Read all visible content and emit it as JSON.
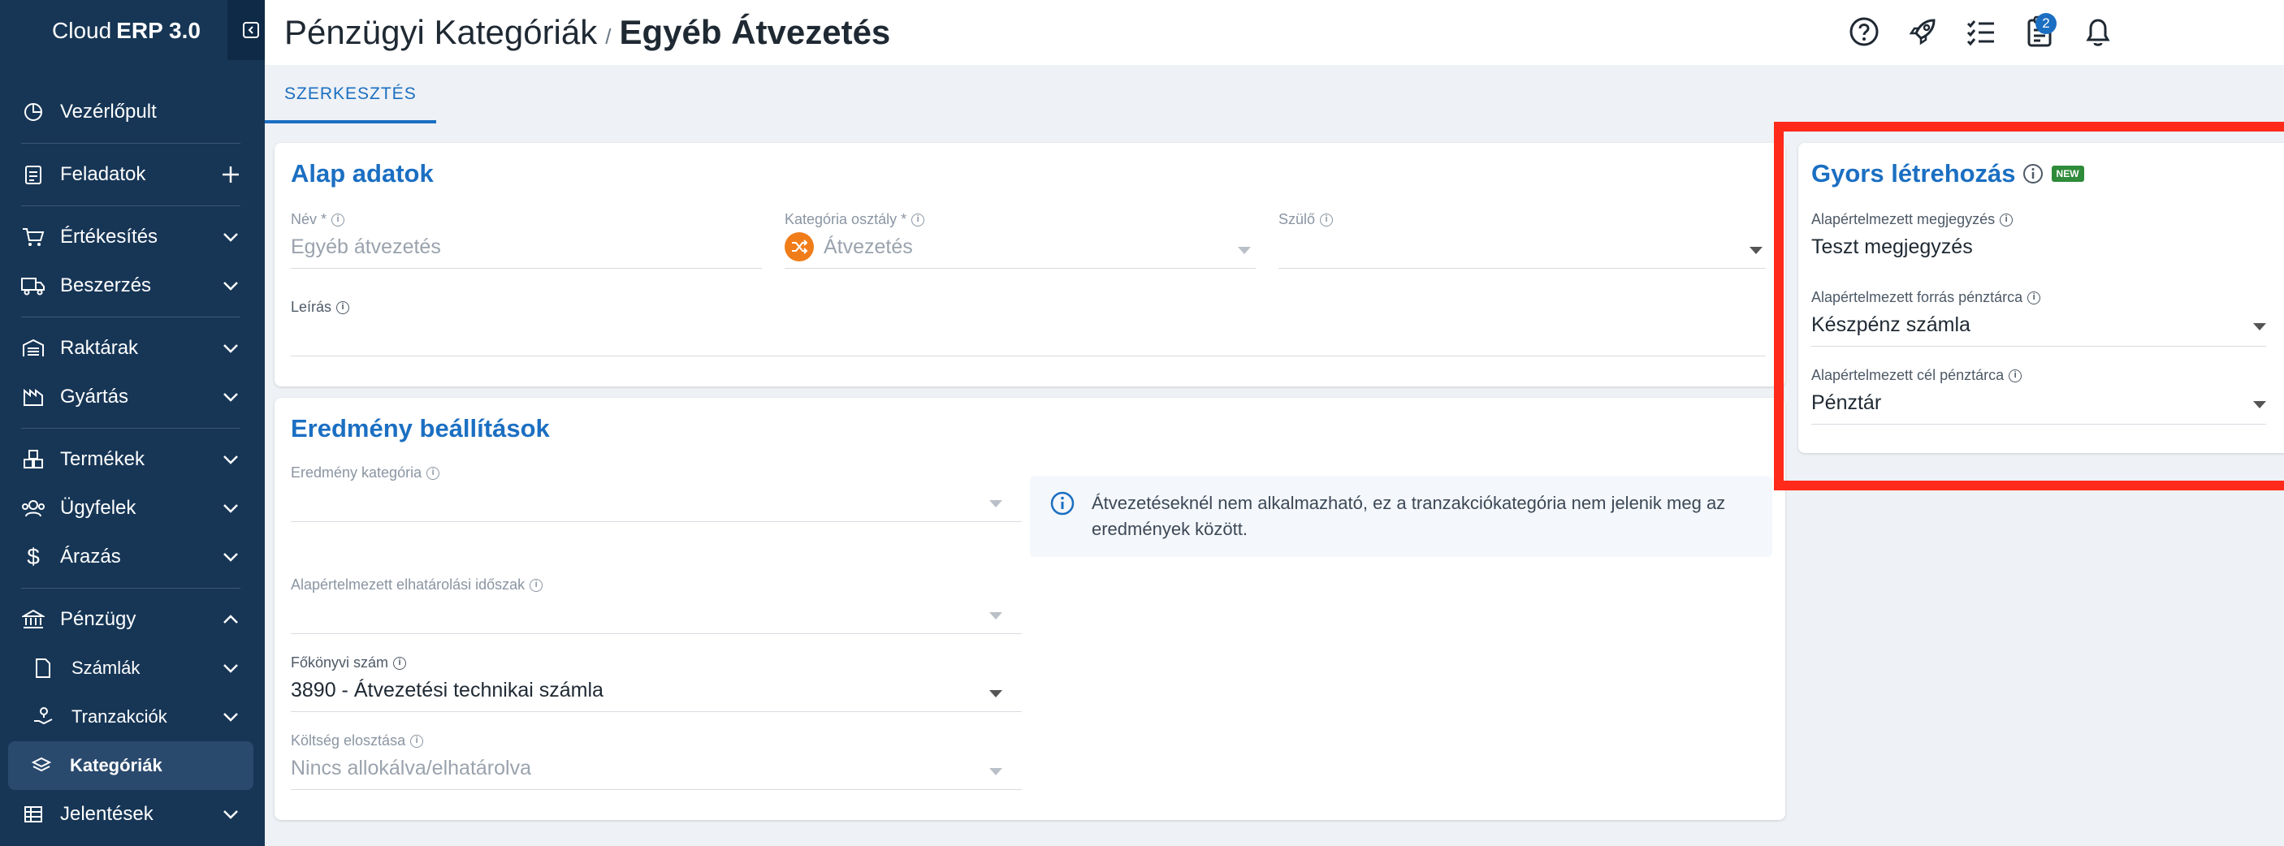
{
  "app": {
    "brand_prefix": "Cloud",
    "brand_bold": "ERP 3.0"
  },
  "sidebar": {
    "items": [
      {
        "label": "Vezérlőpult",
        "icon": "dashboard-icon"
      },
      {
        "label": "Feladatok",
        "icon": "clipboard-icon",
        "action": "plus-icon"
      },
      {
        "label": "Értékesítés",
        "icon": "cart-icon"
      },
      {
        "label": "Beszerzés",
        "icon": "truck-icon"
      },
      {
        "label": "Raktárak",
        "icon": "warehouse-icon"
      },
      {
        "label": "Gyártás",
        "icon": "factory-icon"
      },
      {
        "label": "Termékek",
        "icon": "boxes-icon"
      },
      {
        "label": "Ügyfelek",
        "icon": "users-icon"
      },
      {
        "label": "Árazás",
        "icon": "dollar-icon"
      },
      {
        "label": "Pénzügy",
        "icon": "bank-icon"
      },
      {
        "label": "Számlák",
        "icon": "file-icon"
      },
      {
        "label": "Tranzakciók",
        "icon": "hand-coin-icon"
      },
      {
        "label": "Kategóriák",
        "icon": "layers-icon"
      },
      {
        "label": "Jelentések",
        "icon": "table-icon"
      }
    ]
  },
  "header": {
    "breadcrumb_parent": "Pénzügyi Kategóriák",
    "breadcrumb_sep": "/",
    "title": "Egyéb Átvezetés",
    "notification_count": "2"
  },
  "tabs": [
    {
      "label": "SZERKESZTÉS"
    }
  ],
  "basic": {
    "title": "Alap adatok",
    "name_label": "Név *",
    "name_value": "Egyéb átvezetés",
    "class_label": "Kategória osztály *",
    "class_value": "Átvezetés",
    "parent_label": "Szülő",
    "desc_label": "Leírás"
  },
  "result": {
    "title": "Eredmény beállítások",
    "category_label": "Eredmény kategória",
    "notice": "Átvezetéseknél nem alkalmazható, ez a tranzakciókategória nem jelenik meg az eredmények között.",
    "period_label": "Alapértelmezett elhatárolási időszak",
    "ledger_label": "Főkönyvi szám",
    "ledger_value": "3890 - Átvezetési technikai számla",
    "cost_label": "Költség elosztása",
    "cost_value": "Nincs allokálva/elhatárolva"
  },
  "quick": {
    "title": "Gyors létrehozás",
    "badge": "NEW",
    "note_label": "Alapértelmezett megjegyzés",
    "note_value": "Teszt megjegyzés",
    "source_label": "Alapértelmezett forrás pénztárca",
    "source_value": "Készpénz számla",
    "target_label": "Alapértelmezett cél pénztárca",
    "target_value": "Pénztár"
  },
  "colors": {
    "sidebar": "#173656",
    "accent": "#1b6fc2",
    "highlight": "#ff2a1a",
    "class_icon": "#f07d1a"
  }
}
